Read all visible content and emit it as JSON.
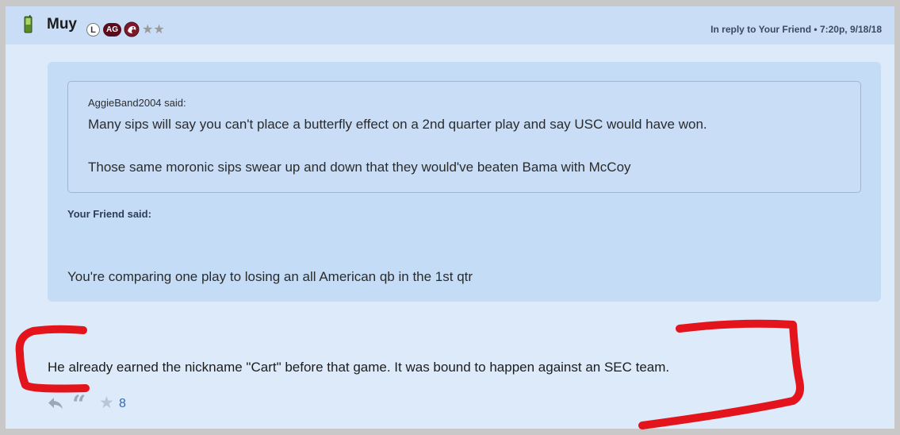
{
  "post": {
    "username": "Muy",
    "badges": {
      "level": "L",
      "team": "AG"
    },
    "device_icon": "phone-icon",
    "rank_stars": "★★",
    "reply_info": "In reply to Your Friend • 7:20p, 9/18/18",
    "quote": {
      "inner": {
        "author": "AggieBand2004 said:",
        "line1": "Many sips will say you can't place a butterfly effect on a 2nd quarter play and say USC would have won.",
        "line2": "Those same moronic sips swear up and down that they would've beaten Bama with McCoy"
      },
      "author": "Your Friend said:",
      "text": "You're comparing one play to losing an all American qb in the 1st qtr"
    },
    "body": "He already earned the nickname \"Cart\" before that game. It was bound to happen against an SEC team.",
    "actions": {
      "reply_icon": "reply-arrow-icon",
      "quote_icon": "quote-icon",
      "star_icon": "star-icon",
      "star_count": "8"
    }
  },
  "colors": {
    "header_bg": "#c9ddf6",
    "post_bg": "#ddeafa",
    "quote_bg": "#c5dcf6",
    "ag_badge": "#5b0c1c",
    "markup_red": "#e3141c",
    "link": "#2f6bb5"
  }
}
